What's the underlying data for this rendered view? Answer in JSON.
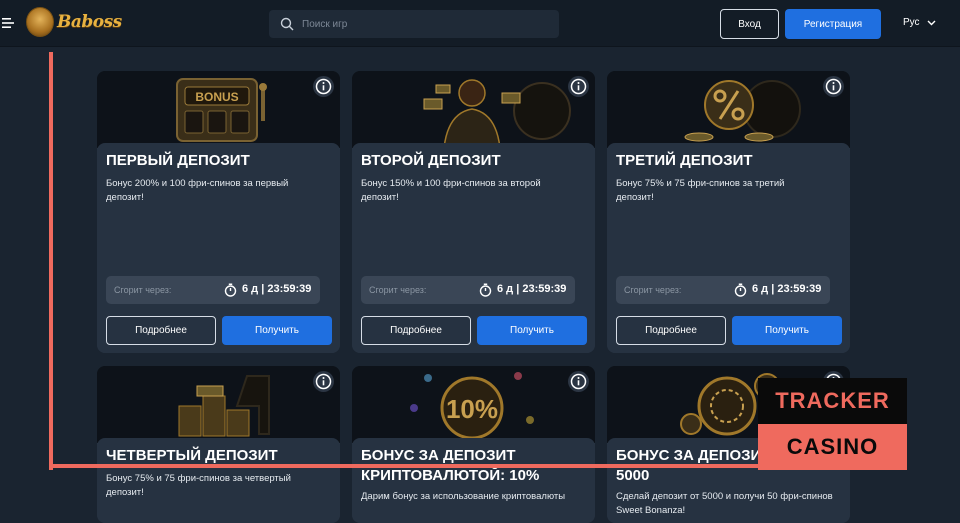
{
  "header": {
    "logo_text": "Baboss",
    "search_placeholder": "Поиск игр",
    "login_label": "Вход",
    "register_label": "Регистрация",
    "language": "Рус"
  },
  "cards": [
    {
      "title": "ПЕРВЫЙ ДЕПОЗИТ",
      "description": "Бонус 200% и 100 фри-спинов за первый депозит!",
      "timer_label": "Сгорит через:",
      "timer_value": "6 д | 23:59:39",
      "more_label": "Подробнее",
      "get_label": "Получить",
      "image_text": "BONUS"
    },
    {
      "title": "ВТОРОЙ ДЕПОЗИТ",
      "description": "Бонус 150% и 100 фри-спинов за второй депозит!",
      "timer_label": "Сгорит через:",
      "timer_value": "6 д | 23:59:39",
      "more_label": "Подробнее",
      "get_label": "Получить"
    },
    {
      "title": "ТРЕТИЙ ДЕПОЗИТ",
      "description": "Бонус 75% и 75 фри-спинов за третий депозит!",
      "timer_label": "Сгорит через:",
      "timer_value": "6 д | 23:59:39",
      "more_label": "Подробнее",
      "get_label": "Получить"
    },
    {
      "title": "ЧЕТВЕРТЫЙ ДЕПОЗИТ",
      "description": "Бонус 75% и 75 фри-спинов за четвертый депозит!"
    },
    {
      "title": "БОНУС ЗА ДЕПОЗИТ КРИПТОВАЛЮТОЙ: 10%",
      "description": "Дарим бонус за использование криптовалюты",
      "image_text": "10%"
    },
    {
      "title": "БОНУС ЗА ДЕПОЗИТ 5000",
      "description": "Сделай депозит от 5000 и получи 50 фри-спинов Sweet Bonanza!"
    }
  ],
  "watermark": {
    "line1": "TRACKER",
    "line2": "CASINO"
  },
  "colors": {
    "accent_blue": "#1f6fe0",
    "watermark_red": "#ef6a5e",
    "background": "#1a2430"
  }
}
